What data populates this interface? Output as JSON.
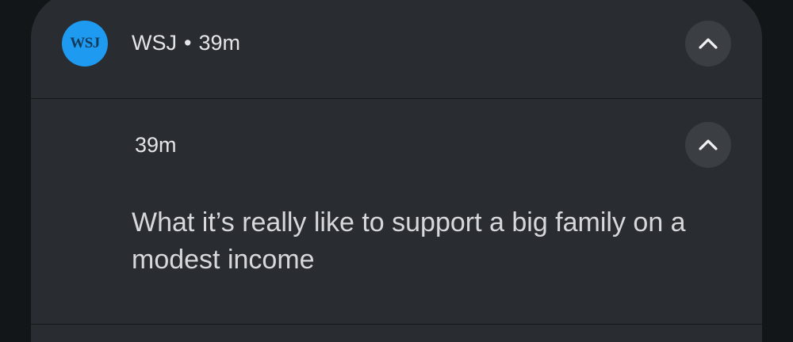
{
  "notification": {
    "app_icon_text": "WSJ",
    "app_name": "WSJ",
    "separator": "•",
    "time": "39m",
    "icons": {
      "expand_header": "chevron-up-icon",
      "expand_child": "chevron-up-icon"
    },
    "colors": {
      "card_bg": "#292c30",
      "app_icon_bg": "#1e9bf0",
      "button_bg": "#3b3e43",
      "text_primary": "#e3e5e8"
    }
  },
  "child_notification": {
    "time": "39m",
    "text": "What it’s really like to support a big family on a modest income"
  }
}
